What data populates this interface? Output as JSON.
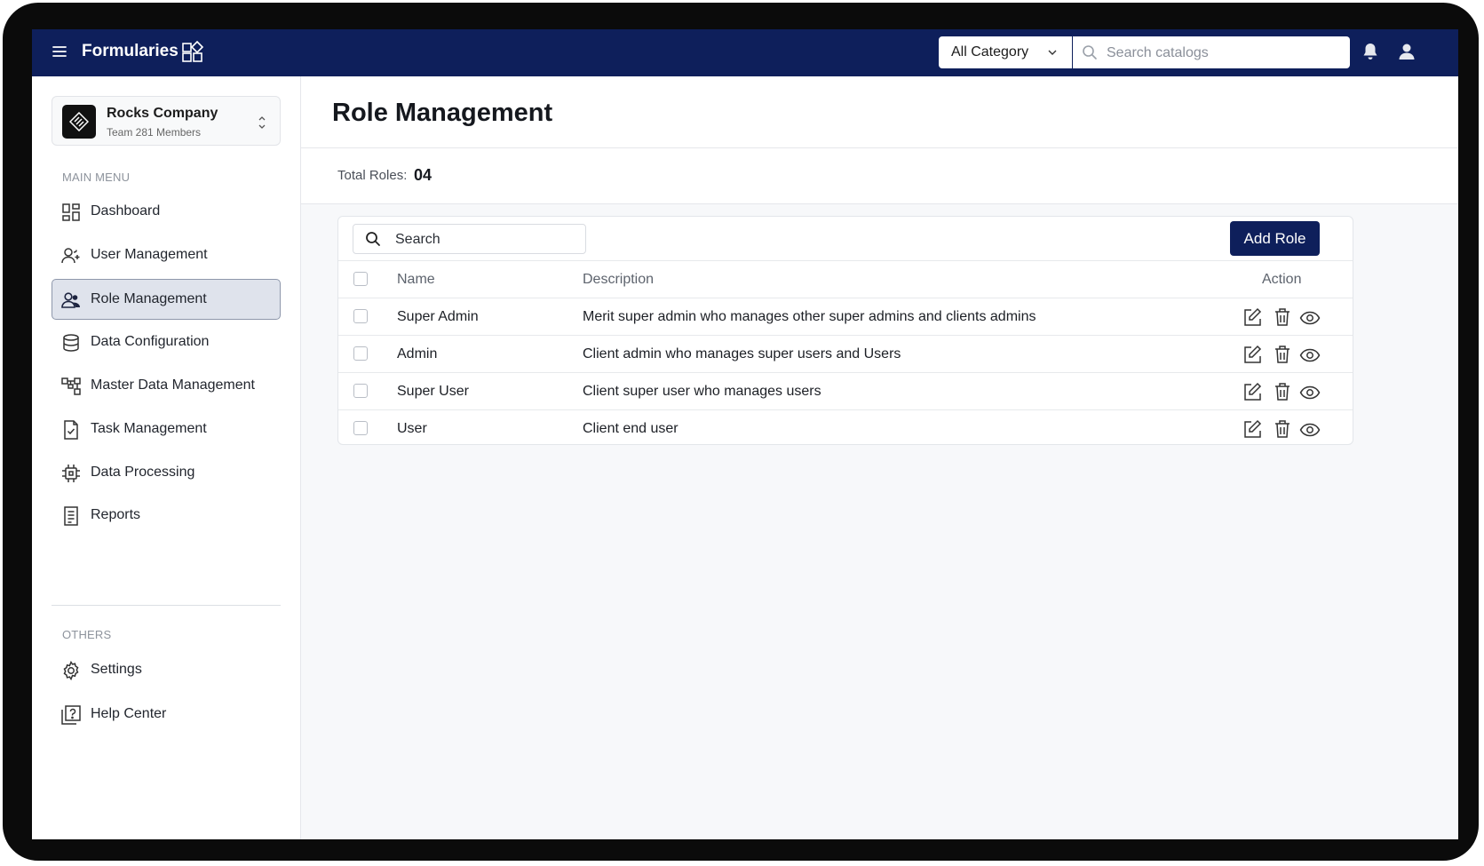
{
  "header": {
    "app_title": "Formularies",
    "category_select": "All Category",
    "search_placeholder": "Search catalogs"
  },
  "sidebar": {
    "company_name": "Rocks Company",
    "company_sub": "Team 281 Members",
    "main_menu_title": "MAIN MENU",
    "main_items": [
      {
        "label": "Dashboard",
        "icon": "dashboard-icon"
      },
      {
        "label": "User Management",
        "icon": "user-add-icon"
      },
      {
        "label": "Role Management",
        "icon": "users-icon",
        "active": true
      },
      {
        "label": "Data Configuration",
        "icon": "database-icon"
      },
      {
        "label": "Master Data Management",
        "icon": "hierarchy-icon"
      },
      {
        "label": "Task Management",
        "icon": "task-icon"
      },
      {
        "label": "Data Processing",
        "icon": "chip-icon"
      },
      {
        "label": "Reports",
        "icon": "report-icon"
      }
    ],
    "others_title": "OTHERS",
    "other_items": [
      {
        "label": "Settings",
        "icon": "gear-icon"
      },
      {
        "label": "Help Center",
        "icon": "help-icon"
      }
    ]
  },
  "main": {
    "page_title": "Role Management",
    "total_roles_label": "Total Roles:",
    "total_roles_value": "04",
    "table": {
      "search_placeholder": "Search",
      "add_button": "Add Role",
      "columns": {
        "name": "Name",
        "description": "Description",
        "action": "Action"
      },
      "rows": [
        {
          "name": "Super Admin",
          "description": "Merit super admin who manages other super admins and clients admins"
        },
        {
          "name": "Admin",
          "description": "Client admin who manages super users and Users"
        },
        {
          "name": "Super User",
          "description": "Client super user who manages users"
        },
        {
          "name": "User",
          "description": "Client end user"
        }
      ]
    }
  },
  "colors": {
    "brand_navy": "#0e1f5b",
    "active_nav_bg": "#dfe3ec"
  }
}
